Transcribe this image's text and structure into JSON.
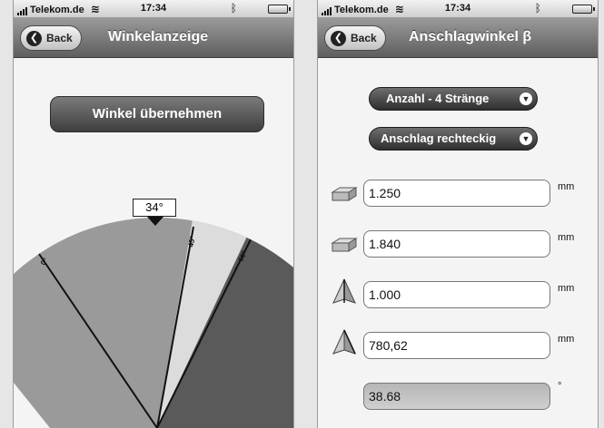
{
  "left": {
    "status": {
      "carrier": "Telekom.de",
      "time": "17:34"
    },
    "nav": {
      "back_label": "Back",
      "title": "Winkelanzeige"
    },
    "take_button": "Winkel übernehmen",
    "angle_display": "34°",
    "ticks": {
      "t0": "0°",
      "t45": "45°",
      "t60": "60°"
    },
    "colors": {
      "zone_mid": "#9a9a9a",
      "zone_light": "#dcdcdc",
      "zone_dark": "#5a5a5a"
    }
  },
  "right": {
    "status": {
      "carrier": "Telekom.de",
      "time": "17:34"
    },
    "nav": {
      "back_label": "Back",
      "title": "Anschlagwinkel β"
    },
    "count_button": "Anzahl - 4 Stränge",
    "shape_button": "Anschlag rechteckig",
    "fields": [
      {
        "icon": "box-length-icon",
        "value": "1.250",
        "unit": "mm"
      },
      {
        "icon": "box-width-icon",
        "value": "1.840",
        "unit": "mm"
      },
      {
        "icon": "pyramid-height-icon",
        "value": "1.000",
        "unit": "mm"
      },
      {
        "icon": "pyramid-sling-icon",
        "value": "780,62",
        "unit": "mm"
      }
    ],
    "result": {
      "value": "38.68",
      "unit": "°"
    }
  }
}
